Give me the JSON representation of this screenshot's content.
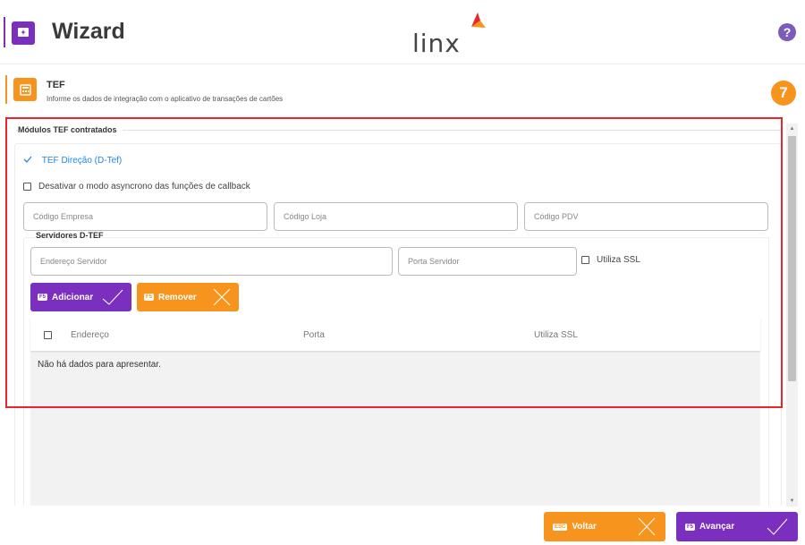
{
  "header": {
    "title": "Wizard",
    "logo_text": "linx",
    "help_label": "?"
  },
  "step": {
    "title": "TEF",
    "description": "Informe os dados de integração com o aplicativo de transações de cartões",
    "number": "7"
  },
  "modules": {
    "legend": "Módulos TEF contratados",
    "tef_option": "TEF Direção (D-Tef)",
    "async_label": "Desativar o modo asyncrono das funções de callback",
    "fields": {
      "empresa_placeholder": "Código Empresa",
      "loja_placeholder": "Código Loja",
      "pdv_placeholder": "Código PDV"
    }
  },
  "servers": {
    "legend": "Servidores D-TEF",
    "endereco_placeholder": "Endereço Servidor",
    "porta_placeholder": "Porta Servidor",
    "ssl_label": "Utiliza SSL",
    "add_button": {
      "key": "F5",
      "label": "Adicionar"
    },
    "remove_button": {
      "key": "F5",
      "label": "Remover"
    },
    "table": {
      "columns": [
        "Endereço",
        "Porta",
        "Utiliza SSL"
      ],
      "empty_message": "Não há dados para apresentar."
    }
  },
  "footer": {
    "back_button": {
      "key": "ESC",
      "label": "Voltar"
    },
    "next_button": {
      "key": "F5",
      "label": "Avançar"
    }
  },
  "colors": {
    "purple": "#7b2fbf",
    "orange": "#f7941d",
    "link_blue": "#1e88e5",
    "highlight_red": "#e8262b"
  }
}
